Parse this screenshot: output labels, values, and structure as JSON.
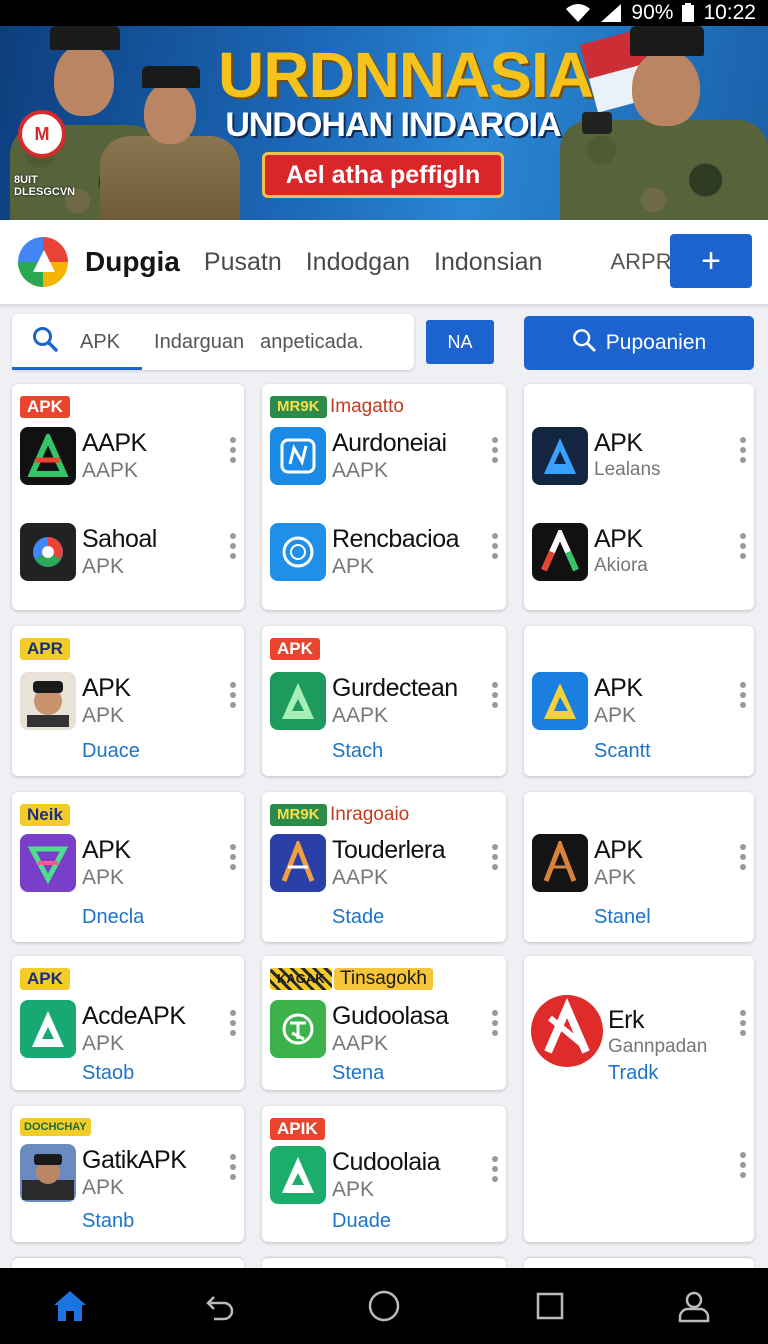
{
  "status": {
    "battery": "90%",
    "time": "10:22"
  },
  "banner": {
    "title": "URDNNASIA",
    "subtitle": "UNDOHAN INDAROIA",
    "ribbon": "Ael atha peffigln",
    "logo_text_1": "8UIT",
    "logo_text_2": "DLESGCVN"
  },
  "appbar": {
    "brand": "Dupgia",
    "nav": [
      "Pusatn",
      "Indodgan",
      "Indonsian"
    ],
    "apkpre": "ARPRC/",
    "add_label": "+"
  },
  "search": {
    "text1": "APK",
    "text2": "Indarguan",
    "text3": "anpeticada.",
    "na_label": "NA",
    "button_label": "Pupoanien"
  },
  "cards": {
    "c1": {
      "badge": "APK",
      "apps": [
        {
          "name": "AAPK",
          "sub": "AAPK"
        },
        {
          "name": "Sahoal",
          "sub": "APK"
        }
      ]
    },
    "c2": {
      "badge": "MR9K",
      "badge_extra": "Imagatto",
      "apps": [
        {
          "name": "Aurdoneiai",
          "sub": "AAPK"
        },
        {
          "name": "Rencbacioa",
          "sub": "APK"
        }
      ]
    },
    "c3": {
      "apps": [
        {
          "name": "APK",
          "sub": "Lealans"
        },
        {
          "name": "APK",
          "sub": "Akiora"
        }
      ]
    },
    "c4": {
      "badge": "APR",
      "name": "APK",
      "sub": "APK",
      "link": "Duace"
    },
    "c5": {
      "badge": "APK",
      "name": "Gurdectean",
      "sub": "AAPK",
      "link": "Stach"
    },
    "c6": {
      "name": "APK",
      "sub": "APK",
      "link": "Scantt"
    },
    "c7": {
      "badge": "Neik",
      "name": "APK",
      "sub": "APK",
      "link": "Dnecla"
    },
    "c8": {
      "badge": "MR9K",
      "badge_extra": "Inragoaio",
      "name": "Touderlera",
      "sub": "AAPK",
      "link": "Stade"
    },
    "c9": {
      "name": "APK",
      "sub": "APK",
      "link": "Stanel"
    },
    "c10": {
      "badge": "APK",
      "name": "AcdeAPK",
      "sub": "APK",
      "link": "Staob"
    },
    "c11": {
      "badge": "KAGAK",
      "badge_extra": "Tinsagokh",
      "name": "Gudoolasa",
      "sub": "AAPK",
      "link": "Stena"
    },
    "c12": {
      "name": "Erk",
      "sub": "Gannpadan",
      "link": "Tradk"
    },
    "c13": {
      "badge": "DOCHCHAY",
      "name": "GatikAPK",
      "sub": "APK",
      "link": "Stanb"
    },
    "c14": {
      "badge": "APIK",
      "name": "Cudoolaia",
      "sub": "APK",
      "link": "Duade"
    }
  },
  "colors": {
    "accent": "#1d63d0",
    "badge_red": "#e8442e",
    "badge_yellow": "#f4cc2a",
    "link": "#1d73c9"
  }
}
